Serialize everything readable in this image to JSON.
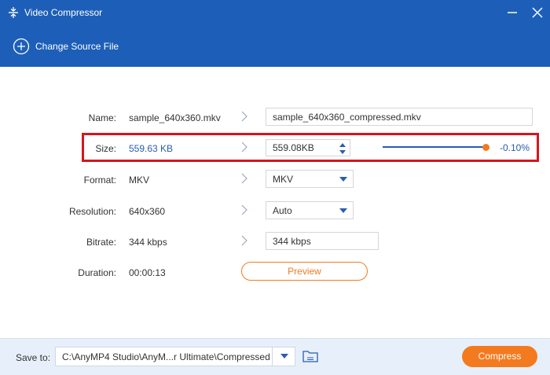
{
  "window": {
    "title": "Video Compressor",
    "app_icon": "compress-icon",
    "minimize_icon": "minimize-icon",
    "close_icon": "close-icon"
  },
  "toolbar": {
    "change_source_label": "Change Source File",
    "change_source_icon": "plus-circle-icon"
  },
  "form": {
    "name": {
      "label": "Name:",
      "source": "sample_640x360.mkv",
      "output": "sample_640x360_compressed.mkv"
    },
    "size": {
      "label": "Size:",
      "source": "559.63 KB",
      "output": "559.08KB",
      "slider_fraction": 0.999,
      "percent": "-0.10%"
    },
    "format": {
      "label": "Format:",
      "source": "MKV",
      "output": "MKV"
    },
    "resolution": {
      "label": "Resolution:",
      "source": "640x360",
      "output": "Auto"
    },
    "bitrate": {
      "label": "Bitrate:",
      "source": "344 kbps",
      "output": "344 kbps"
    },
    "duration": {
      "label": "Duration:",
      "source": "00:00:13"
    }
  },
  "preview_label": "Preview",
  "footer": {
    "save_to_label": "Save to:",
    "save_path": "C:\\AnyMP4 Studio\\AnyM...r Ultimate\\Compressed",
    "folder_icon": "folder-icon",
    "compress_label": "Compress"
  },
  "colors": {
    "header_blue": "#1d5fb8",
    "accent_blue": "#2a5cb0",
    "accent_orange": "#f47a1f",
    "highlight_red": "#d8141c",
    "footer_bg": "#e7f0fa"
  }
}
